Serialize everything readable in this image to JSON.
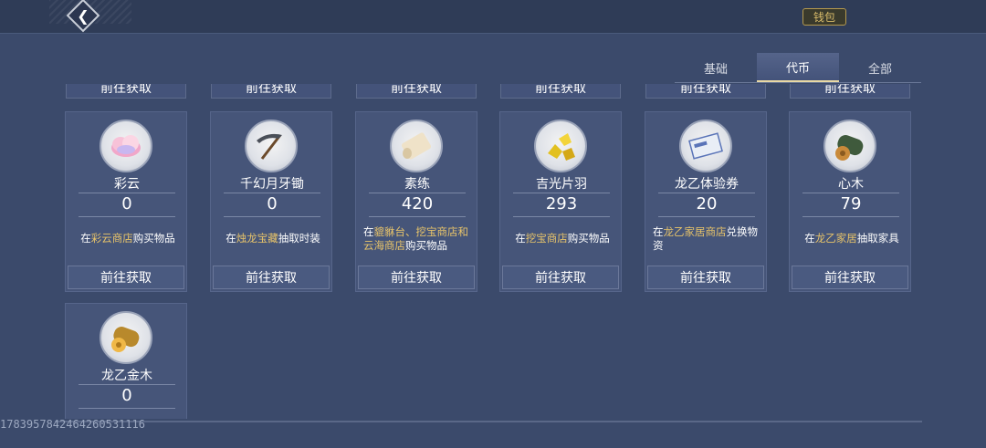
{
  "header": {
    "back_icon": "chevron-left-icon",
    "wallet_label": "钱包"
  },
  "tabs": [
    {
      "label": "基础",
      "active": false
    },
    {
      "label": "代币",
      "active": true
    },
    {
      "label": "全部",
      "active": false
    }
  ],
  "partial_row": {
    "button_label": "前往获取"
  },
  "items": [
    {
      "name": "彩云",
      "count": "0",
      "desc_pre": "在",
      "desc_hl": "彩云商店",
      "desc_post": "购买物品",
      "icon": "cloud-icon",
      "button": "前往获取"
    },
    {
      "name": "千幻月牙锄",
      "count": "0",
      "desc_pre": "在",
      "desc_hl": "烛龙宝藏",
      "desc_post": "抽取时装",
      "icon": "hoe-icon",
      "button": "前往获取"
    },
    {
      "name": "素练",
      "count": "420",
      "desc_pre": "在",
      "desc_hl": "貔貅台、挖宝商店和云海商店",
      "desc_post": "购买物品",
      "icon": "silk-scroll-icon",
      "button": "前往获取"
    },
    {
      "name": "吉光片羽",
      "count": "293",
      "desc_pre": "在",
      "desc_hl": "挖宝商店",
      "desc_post": "购买物品",
      "icon": "gold-nugget-icon",
      "button": "前往获取"
    },
    {
      "name": "龙乙体验券",
      "count": "20",
      "desc_pre": "在",
      "desc_hl": "龙乙家居商店",
      "desc_post": "兑换物资",
      "icon": "ticket-icon",
      "button": "前往获取"
    },
    {
      "name": "心木",
      "count": "79",
      "desc_pre": "在",
      "desc_hl": "龙乙家居",
      "desc_post": "抽取家具",
      "icon": "wood-log-icon",
      "button": "前往获取"
    },
    {
      "name": "龙乙金木",
      "count": "0",
      "desc_pre": "",
      "desc_hl": "",
      "desc_post": "",
      "icon": "golden-log-icon",
      "button": ""
    }
  ],
  "footer": {
    "uid": "1783957842464260531116"
  }
}
